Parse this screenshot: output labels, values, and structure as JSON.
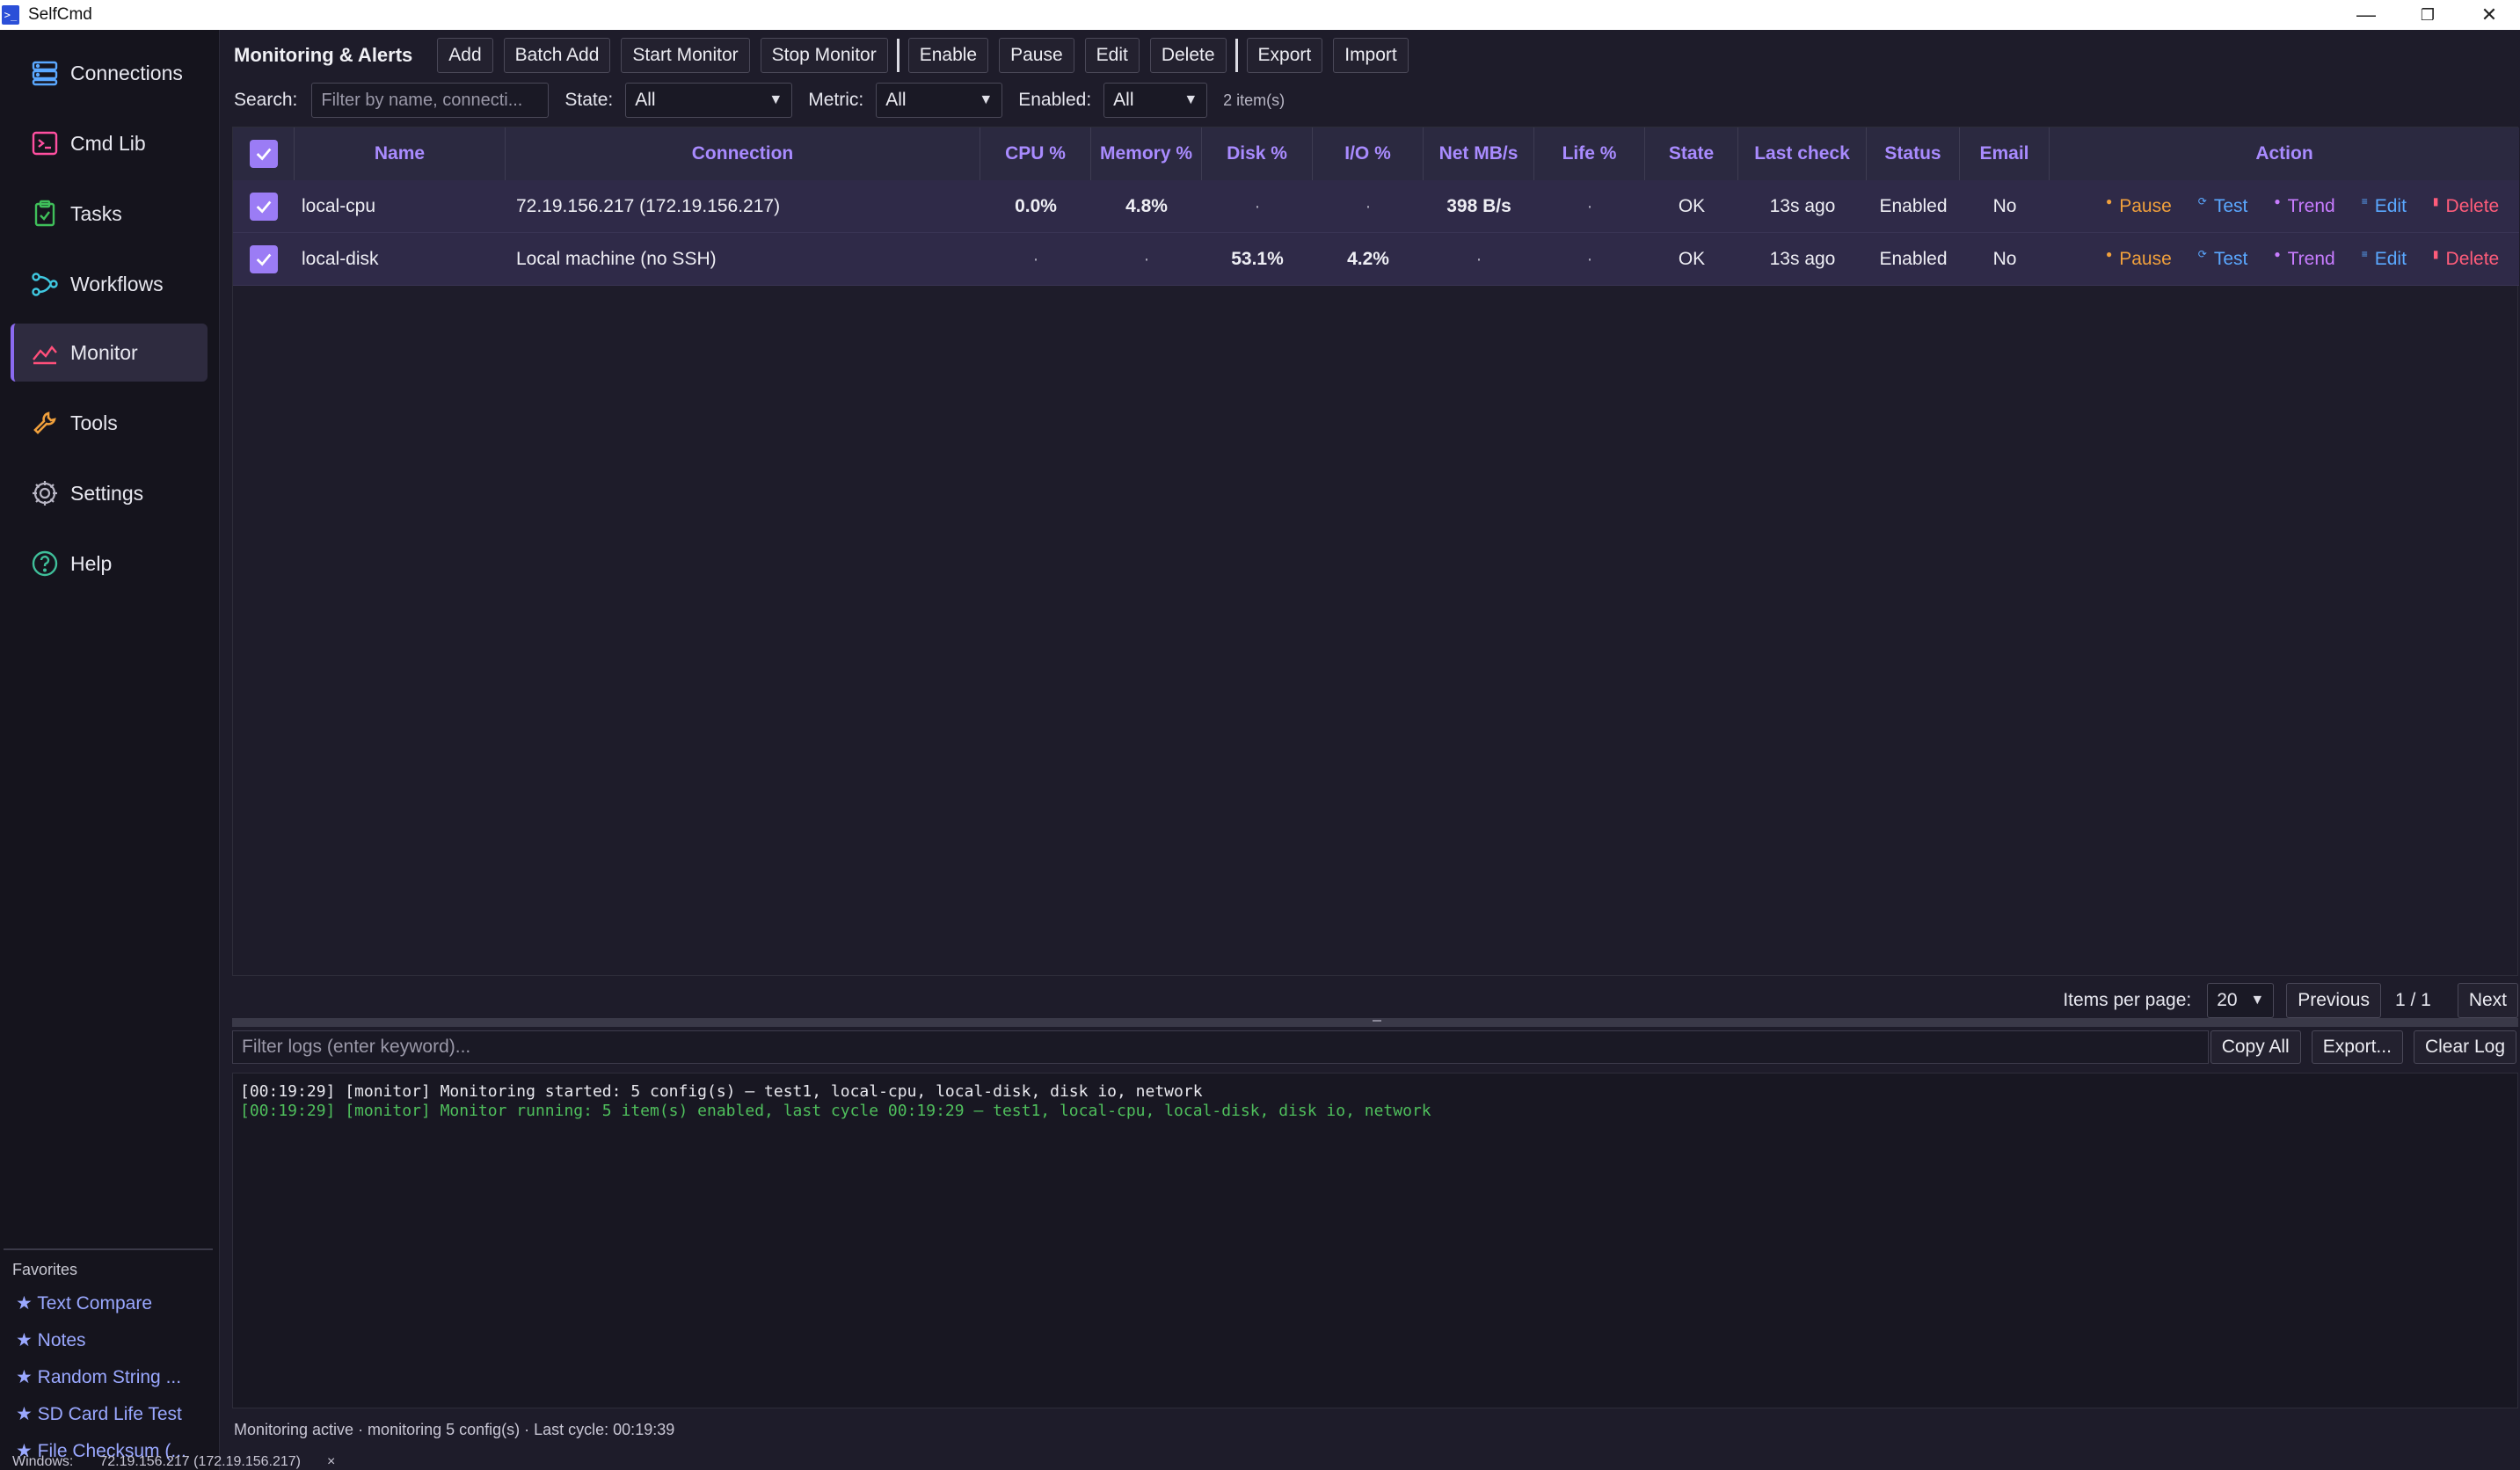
{
  "app": {
    "title": "SelfCmd",
    "logo_glyph": ">_"
  },
  "window_controls": {
    "minimize": "—",
    "maximize": "❐",
    "close": "✕"
  },
  "sidebar": {
    "items": [
      {
        "label": "Connections",
        "icon": "server-icon",
        "color": "#5aa8ff"
      },
      {
        "label": "Cmd Lib",
        "icon": "terminal-icon",
        "color": "#ff4fa0"
      },
      {
        "label": "Tasks",
        "icon": "clipboard-check-icon",
        "color": "#3fbf5a"
      },
      {
        "label": "Workflows",
        "icon": "workflow-icon",
        "color": "#3fc8e0"
      },
      {
        "label": "Monitor",
        "icon": "chart-line-icon",
        "color": "#ff4f7a",
        "active": true
      },
      {
        "label": "Tools",
        "icon": "wrench-icon",
        "color": "#f0a03c"
      },
      {
        "label": "Settings",
        "icon": "gear-icon",
        "color": "#b8b6c4"
      },
      {
        "label": "Help",
        "icon": "help-circle-icon",
        "color": "#3fbf9a"
      }
    ],
    "favorites_title": "Favorites",
    "favorites": [
      "★ Text Compare",
      "★ Notes",
      "★ Random String ...",
      "★ SD Card Life Test",
      "★ File Checksum (..."
    ]
  },
  "toolbar": {
    "title": "Monitoring & Alerts",
    "buttons_a": [
      "Add",
      "Batch Add",
      "Start Monitor",
      "Stop Monitor"
    ],
    "buttons_b": [
      "Enable",
      "Pause",
      "Edit",
      "Delete"
    ],
    "buttons_c": [
      "Export",
      "Import"
    ]
  },
  "filters": {
    "search_label": "Search:",
    "search_placeholder": "Filter by name, connecti...",
    "state_label": "State:",
    "state_value": "All",
    "metric_label": "Metric:",
    "metric_value": "All",
    "enabled_label": "Enabled:",
    "enabled_value": "All",
    "count": "2 item(s)"
  },
  "table": {
    "headers": [
      "Name",
      "Connection",
      "CPU %",
      "Memory %",
      "Disk %",
      "I/O %",
      "Net MB/s",
      "Life %",
      "State",
      "Last check",
      "Status",
      "Email",
      "Action"
    ],
    "rows": [
      {
        "name": "local-cpu",
        "connection": "72.19.156.217 (172.19.156.217)",
        "cpu": "0.0%",
        "memory": "4.8%",
        "disk": "·",
        "io": "·",
        "net": "398 B/s",
        "life": "·",
        "state": "OK",
        "last_check": "13s ago",
        "status": "Enabled",
        "email": "No"
      },
      {
        "name": "local-disk",
        "connection": "Local machine (no SSH)",
        "cpu": "·",
        "memory": "·",
        "disk": "53.1%",
        "io": "4.2%",
        "net": "·",
        "life": "·",
        "state": "OK",
        "last_check": "13s ago",
        "status": "Enabled",
        "email": "No"
      }
    ],
    "actions": {
      "pause": "Pause",
      "test": "Test",
      "trend": "Trend",
      "edit": "Edit",
      "delete": "Delete"
    }
  },
  "pager": {
    "label": "Items per page:",
    "per_page": "20",
    "previous": "Previous",
    "position": "1 / 1",
    "next": "Next"
  },
  "log": {
    "filter_placeholder": "Filter logs (enter keyword)...",
    "copy_all": "Copy All",
    "export": "Export...",
    "clear": "Clear Log",
    "lines": [
      "[00:19:29] [monitor] Monitoring started: 5 config(s) — test1, local-cpu, local-disk, disk io, network",
      "[00:19:29] [monitor] Monitor running: 5 item(s) enabled, last cycle 00:19:29 — test1, local-cpu, local-disk, disk io, network"
    ]
  },
  "status_line": "Monitoring active · monitoring 5 config(s) · Last cycle: 00:19:39",
  "bottom_strip": {
    "label": "Windows:",
    "value": "72.19.156.217 (172.19.156.217)",
    "close": "×"
  }
}
